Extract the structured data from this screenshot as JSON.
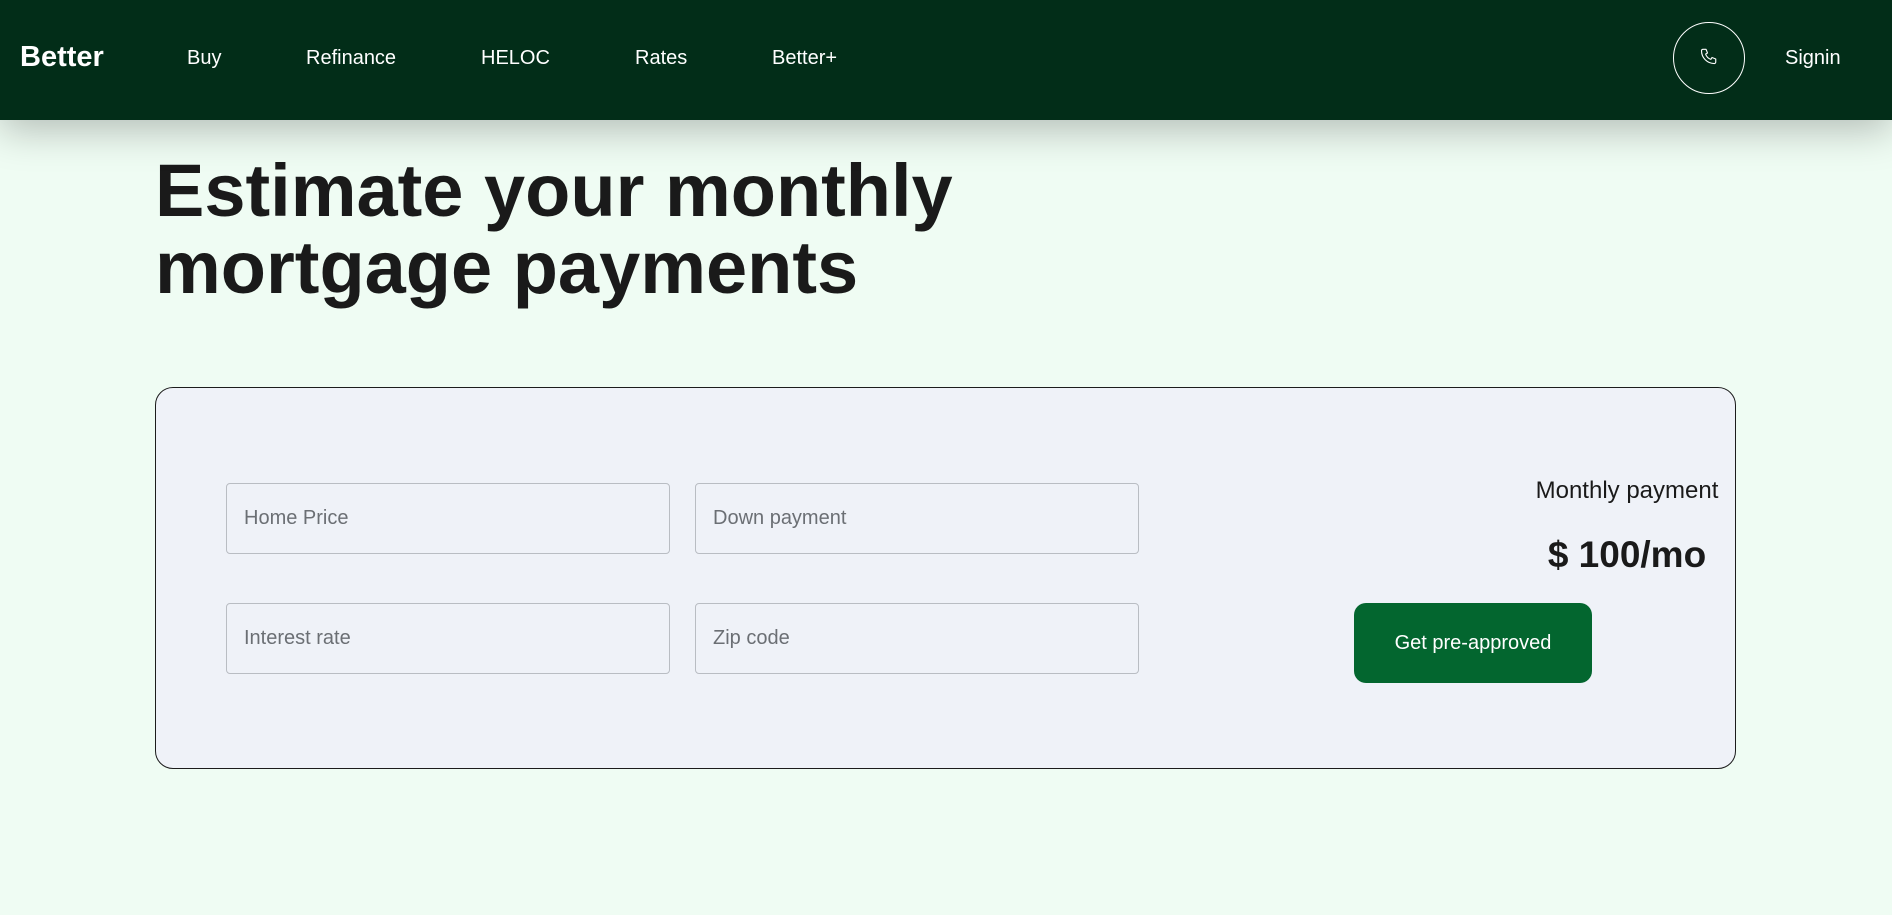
{
  "nav": {
    "brand": "Better",
    "links": [
      "Buy",
      "Refinance",
      "HELOC",
      "Rates",
      "Better+"
    ],
    "phone_icon": "phone-icon",
    "signin": "Signin"
  },
  "hero": {
    "title": "Estimate your monthly mortgage payments"
  },
  "calculator": {
    "fields": {
      "home_price_placeholder": "Home Price",
      "down_payment_placeholder": "Down payment",
      "interest_rate_placeholder": "Interest rate",
      "zip_code_placeholder": "Zip code"
    },
    "result": {
      "label": "Monthly payment",
      "amount": "$ 100/mo"
    },
    "cta": "Get pre-approved"
  },
  "colors": {
    "nav_bg": "#022d18",
    "page_bg": "#effcf3",
    "card_bg": "#eff2f8",
    "cta_bg": "#03662f"
  }
}
